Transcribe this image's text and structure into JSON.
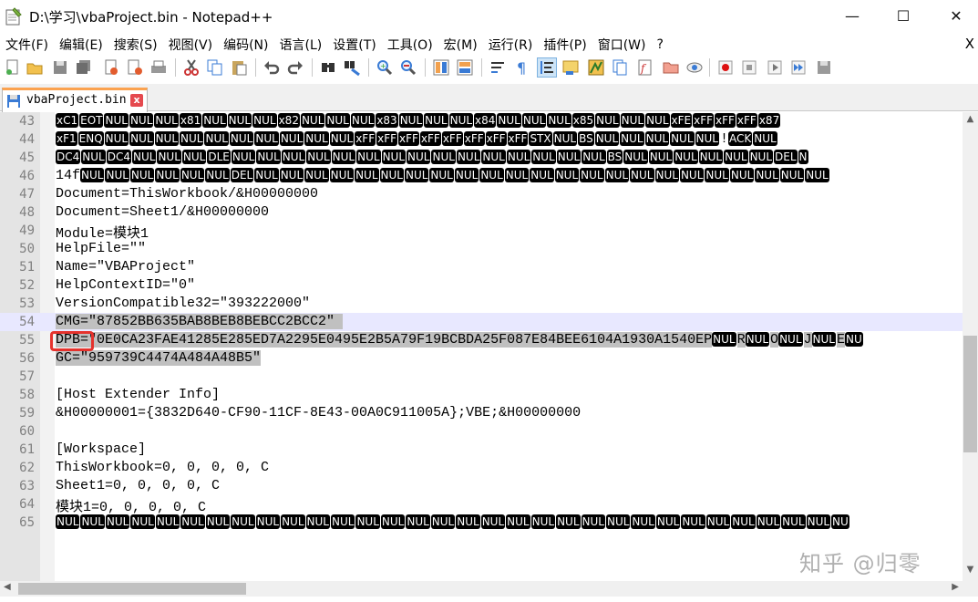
{
  "window": {
    "title": "D:\\学习\\vbaProject.bin - Notepad++",
    "min_glyph": "—",
    "max_glyph": "☐",
    "close_glyph": "✕"
  },
  "menu": {
    "items": [
      "文件(F)",
      "编辑(E)",
      "搜索(S)",
      "视图(V)",
      "编码(N)",
      "语言(L)",
      "设置(T)",
      "工具(O)",
      "宏(M)",
      "运行(R)",
      "插件(P)",
      "窗口(W)",
      "?"
    ],
    "close_glyph": "X"
  },
  "toolbar": {
    "icons": [
      "new-file-icon",
      "open-file-icon",
      "save-icon",
      "save-all-icon",
      "close-icon",
      "close-all-icon",
      "print-icon",
      "cut-icon",
      "copy-icon",
      "paste-icon",
      "undo-icon",
      "redo-icon",
      "find-icon",
      "replace-icon",
      "zoom-in-icon",
      "zoom-out-icon",
      "sync-v-icon",
      "sync-h-icon",
      "word-wrap-icon",
      "show-all-chars-icon",
      "indent-guide-icon",
      "udl-icon",
      "doc-map-icon",
      "doc-list-icon",
      "function-list-icon",
      "folder-workspace-icon",
      "monitor-icon",
      "record-macro-icon",
      "stop-macro-icon",
      "play-macro-icon",
      "run-macro-multiple-icon",
      "save-macro-icon"
    ]
  },
  "tab": {
    "label": "vbaProject.bin",
    "close_glyph": "x"
  },
  "editor": {
    "current_line": 54,
    "lines": [
      {
        "num": "43",
        "segments": [
          {
            "c": "x",
            "t": "xC1"
          },
          {
            "c": "x",
            "t": "EOT"
          },
          {
            "c": "x",
            "t": "NUL"
          },
          {
            "c": "x",
            "t": "NUL"
          },
          {
            "c": "x",
            "t": "NUL"
          },
          {
            "c": "x",
            "t": "x81"
          },
          {
            "c": "x",
            "t": "NUL"
          },
          {
            "c": "x",
            "t": "NUL"
          },
          {
            "c": "x",
            "t": "NUL"
          },
          {
            "c": "x",
            "t": "x82"
          },
          {
            "c": "x",
            "t": "NUL"
          },
          {
            "c": "x",
            "t": "NUL"
          },
          {
            "c": "x",
            "t": "NUL"
          },
          {
            "c": "x",
            "t": "x83"
          },
          {
            "c": "x",
            "t": "NUL"
          },
          {
            "c": "x",
            "t": "NUL"
          },
          {
            "c": "x",
            "t": "NUL"
          },
          {
            "c": "x",
            "t": "x84"
          },
          {
            "c": "x",
            "t": "NUL"
          },
          {
            "c": "x",
            "t": "NUL"
          },
          {
            "c": "x",
            "t": "NUL"
          },
          {
            "c": "x",
            "t": "x85"
          },
          {
            "c": "x",
            "t": "NUL"
          },
          {
            "c": "x",
            "t": "NUL"
          },
          {
            "c": "x",
            "t": "NUL"
          },
          {
            "c": "x",
            "t": "xFE"
          },
          {
            "c": "x",
            "t": "xFF"
          },
          {
            "c": "x",
            "t": "xFF"
          },
          {
            "c": "x",
            "t": "xFF"
          },
          {
            "c": "x",
            "t": "x87"
          }
        ]
      },
      {
        "num": "44",
        "segments": [
          {
            "c": "x",
            "t": "xF1"
          },
          {
            "c": "x",
            "t": "ENQ"
          },
          {
            "c": "x",
            "t": "NUL"
          },
          {
            "c": "x",
            "t": "NUL"
          },
          {
            "c": "x",
            "t": "NUL"
          },
          {
            "c": "x",
            "t": "NUL"
          },
          {
            "c": "x",
            "t": "NUL"
          },
          {
            "c": "x",
            "t": "NUL"
          },
          {
            "c": "x",
            "t": "NUL"
          },
          {
            "c": "x",
            "t": "NUL"
          },
          {
            "c": "x",
            "t": "NUL"
          },
          {
            "c": "x",
            "t": "NUL"
          },
          {
            "c": "x",
            "t": "xFF"
          },
          {
            "c": "x",
            "t": "xFF"
          },
          {
            "c": "x",
            "t": "xFF"
          },
          {
            "c": "x",
            "t": "xFF"
          },
          {
            "c": "x",
            "t": "xFF"
          },
          {
            "c": "x",
            "t": "xFF"
          },
          {
            "c": "x",
            "t": "xFF"
          },
          {
            "c": "x",
            "t": "xFF"
          },
          {
            "c": "x",
            "t": "STX"
          },
          {
            "c": "x",
            "t": "NUL"
          },
          {
            "c": "x",
            "t": "BS"
          },
          {
            "c": "x",
            "t": "NUL"
          },
          {
            "c": "x",
            "t": "NUL"
          },
          {
            "c": "x",
            "t": "NUL"
          },
          {
            "c": "x",
            "t": "NUL"
          },
          {
            "c": "x",
            "t": "NUL"
          },
          {
            "c": "p",
            "t": "!"
          },
          {
            "c": "x",
            "t": "ACK"
          },
          {
            "c": "x",
            "t": "NUL"
          }
        ]
      },
      {
        "num": "45",
        "segments": [
          {
            "c": "x",
            "t": "DC4"
          },
          {
            "c": "x",
            "t": "NUL"
          },
          {
            "c": "x",
            "t": "DC4"
          },
          {
            "c": "x",
            "t": "NUL"
          },
          {
            "c": "x",
            "t": "NUL"
          },
          {
            "c": "x",
            "t": "NUL"
          },
          {
            "c": "x",
            "t": "DLE"
          },
          {
            "c": "x",
            "t": "NUL"
          },
          {
            "c": "x",
            "t": "NUL"
          },
          {
            "c": "x",
            "t": "NUL"
          },
          {
            "c": "x",
            "t": "NUL"
          },
          {
            "c": "x",
            "t": "NUL"
          },
          {
            "c": "x",
            "t": "NUL"
          },
          {
            "c": "x",
            "t": "NUL"
          },
          {
            "c": "x",
            "t": "NUL"
          },
          {
            "c": "x",
            "t": "NUL"
          },
          {
            "c": "x",
            "t": "NUL"
          },
          {
            "c": "x",
            "t": "NUL"
          },
          {
            "c": "x",
            "t": "NUL"
          },
          {
            "c": "x",
            "t": "NUL"
          },
          {
            "c": "x",
            "t": "NUL"
          },
          {
            "c": "x",
            "t": "NUL"
          },
          {
            "c": "x",
            "t": "BS"
          },
          {
            "c": "x",
            "t": "NUL"
          },
          {
            "c": "x",
            "t": "NUL"
          },
          {
            "c": "x",
            "t": "NUL"
          },
          {
            "c": "x",
            "t": "NUL"
          },
          {
            "c": "x",
            "t": "NUL"
          },
          {
            "c": "x",
            "t": "NUL"
          },
          {
            "c": "x",
            "t": "DEL"
          },
          {
            "c": "x",
            "t": "N"
          }
        ]
      },
      {
        "num": "46",
        "segments": [
          {
            "c": "p",
            "t": "14f"
          },
          {
            "c": "x",
            "t": "NUL"
          },
          {
            "c": "x",
            "t": "NUL"
          },
          {
            "c": "x",
            "t": "NUL"
          },
          {
            "c": "x",
            "t": "NUL"
          },
          {
            "c": "x",
            "t": "NUL"
          },
          {
            "c": "x",
            "t": "NUL"
          },
          {
            "c": "x",
            "t": "DEL"
          },
          {
            "c": "x",
            "t": "NUL"
          },
          {
            "c": "x",
            "t": "NUL"
          },
          {
            "c": "x",
            "t": "NUL"
          },
          {
            "c": "x",
            "t": "NUL"
          },
          {
            "c": "x",
            "t": "NUL"
          },
          {
            "c": "x",
            "t": "NUL"
          },
          {
            "c": "x",
            "t": "NUL"
          },
          {
            "c": "x",
            "t": "NUL"
          },
          {
            "c": "x",
            "t": "NUL"
          },
          {
            "c": "x",
            "t": "NUL"
          },
          {
            "c": "x",
            "t": "NUL"
          },
          {
            "c": "x",
            "t": "NUL"
          },
          {
            "c": "x",
            "t": "NUL"
          },
          {
            "c": "x",
            "t": "NUL"
          },
          {
            "c": "x",
            "t": "NUL"
          },
          {
            "c": "x",
            "t": "NUL"
          },
          {
            "c": "x",
            "t": "NUL"
          },
          {
            "c": "x",
            "t": "NUL"
          },
          {
            "c": "x",
            "t": "NUL"
          },
          {
            "c": "x",
            "t": "NUL"
          },
          {
            "c": "x",
            "t": "NUL"
          },
          {
            "c": "x",
            "t": "NUL"
          },
          {
            "c": "x",
            "t": "NUL"
          }
        ]
      },
      {
        "num": "47",
        "segments": [
          {
            "c": "p",
            "t": "Document=ThisWorkbook/&H00000000"
          }
        ]
      },
      {
        "num": "48",
        "segments": [
          {
            "c": "p",
            "t": "Document=Sheet1/&H00000000"
          }
        ]
      },
      {
        "num": "49",
        "segments": [
          {
            "c": "p",
            "t": "Module=模块1"
          }
        ]
      },
      {
        "num": "50",
        "segments": [
          {
            "c": "p",
            "t": "HelpFile=\"\""
          }
        ]
      },
      {
        "num": "51",
        "segments": [
          {
            "c": "p",
            "t": "Name=\"VBAProject\""
          }
        ]
      },
      {
        "num": "52",
        "segments": [
          {
            "c": "p",
            "t": "HelpContextID=\"0\""
          }
        ]
      },
      {
        "num": "53",
        "segments": [
          {
            "c": "p",
            "t": "VersionCompatible32=\"393222000\""
          }
        ]
      },
      {
        "num": "54",
        "segments": [
          {
            "c": "s",
            "t": "CMG=\"87852BB635BAB8BEB8BEBCC2BCC2\" "
          }
        ]
      },
      {
        "num": "55",
        "segments": [
          {
            "c": "s",
            "t": "DPB=\"0E0CA23FAE41285E285ED7A2295E0495E2B5A79F19BCBDA25F087E84BEE6104A1930A1540EP"
          },
          {
            "c": "x",
            "t": "NUL"
          },
          {
            "c": "s",
            "t": "R"
          },
          {
            "c": "x",
            "t": "NUL"
          },
          {
            "c": "s",
            "t": "O"
          },
          {
            "c": "x",
            "t": "NUL"
          },
          {
            "c": "s",
            "t": "J"
          },
          {
            "c": "x",
            "t": "NUL"
          },
          {
            "c": "s",
            "t": "E"
          },
          {
            "c": "x",
            "t": "NU"
          }
        ]
      },
      {
        "num": "56",
        "segments": [
          {
            "c": "s",
            "t": "GC=\"959739C4474A484A48B5\""
          }
        ]
      },
      {
        "num": "57",
        "segments": [
          {
            "c": "p",
            "t": ""
          }
        ]
      },
      {
        "num": "58",
        "segments": [
          {
            "c": "p",
            "t": "[Host Extender Info]"
          }
        ]
      },
      {
        "num": "59",
        "segments": [
          {
            "c": "p",
            "t": "&H00000001={3832D640-CF90-11CF-8E43-00A0C911005A};VBE;&H00000000"
          }
        ]
      },
      {
        "num": "60",
        "segments": [
          {
            "c": "p",
            "t": ""
          }
        ]
      },
      {
        "num": "61",
        "segments": [
          {
            "c": "p",
            "t": "[Workspace]"
          }
        ]
      },
      {
        "num": "62",
        "segments": [
          {
            "c": "p",
            "t": "ThisWorkbook=0, 0, 0, 0, C"
          }
        ]
      },
      {
        "num": "63",
        "segments": [
          {
            "c": "p",
            "t": "Sheet1=0, 0, 0, 0, C"
          }
        ]
      },
      {
        "num": "64",
        "segments": [
          {
            "c": "p",
            "t": "模块1=0, 0, 0, 0, C"
          }
        ]
      },
      {
        "num": "65",
        "segments": [
          {
            "c": "x",
            "t": "NUL"
          },
          {
            "c": "x",
            "t": "NUL"
          },
          {
            "c": "x",
            "t": "NUL"
          },
          {
            "c": "x",
            "t": "NUL"
          },
          {
            "c": "x",
            "t": "NUL"
          },
          {
            "c": "x",
            "t": "NUL"
          },
          {
            "c": "x",
            "t": "NUL"
          },
          {
            "c": "x",
            "t": "NUL"
          },
          {
            "c": "x",
            "t": "NUL"
          },
          {
            "c": "x",
            "t": "NUL"
          },
          {
            "c": "x",
            "t": "NUL"
          },
          {
            "c": "x",
            "t": "NUL"
          },
          {
            "c": "x",
            "t": "NUL"
          },
          {
            "c": "x",
            "t": "NUL"
          },
          {
            "c": "x",
            "t": "NUL"
          },
          {
            "c": "x",
            "t": "NUL"
          },
          {
            "c": "x",
            "t": "NUL"
          },
          {
            "c": "x",
            "t": "NUL"
          },
          {
            "c": "x",
            "t": "NUL"
          },
          {
            "c": "x",
            "t": "NUL"
          },
          {
            "c": "x",
            "t": "NUL"
          },
          {
            "c": "x",
            "t": "NUL"
          },
          {
            "c": "x",
            "t": "NUL"
          },
          {
            "c": "x",
            "t": "NUL"
          },
          {
            "c": "x",
            "t": "NUL"
          },
          {
            "c": "x",
            "t": "NUL"
          },
          {
            "c": "x",
            "t": "NUL"
          },
          {
            "c": "x",
            "t": "NUL"
          },
          {
            "c": "x",
            "t": "NUL"
          },
          {
            "c": "x",
            "t": "NUL"
          },
          {
            "c": "x",
            "t": "NUL"
          },
          {
            "c": "x",
            "t": "NU"
          }
        ]
      }
    ]
  },
  "scrollbar": {
    "up_glyph": "▲",
    "down_glyph": "▼",
    "left_glyph": "◀",
    "right_glyph": "▶"
  },
  "watermark": "知乎 @归零",
  "colors": {
    "accent_tab": "#fba24f",
    "highlight_box": "#e5322d",
    "current_line": "#e8e8ff",
    "selection": "#c0c0c0",
    "control_char_bg": "#000000"
  }
}
